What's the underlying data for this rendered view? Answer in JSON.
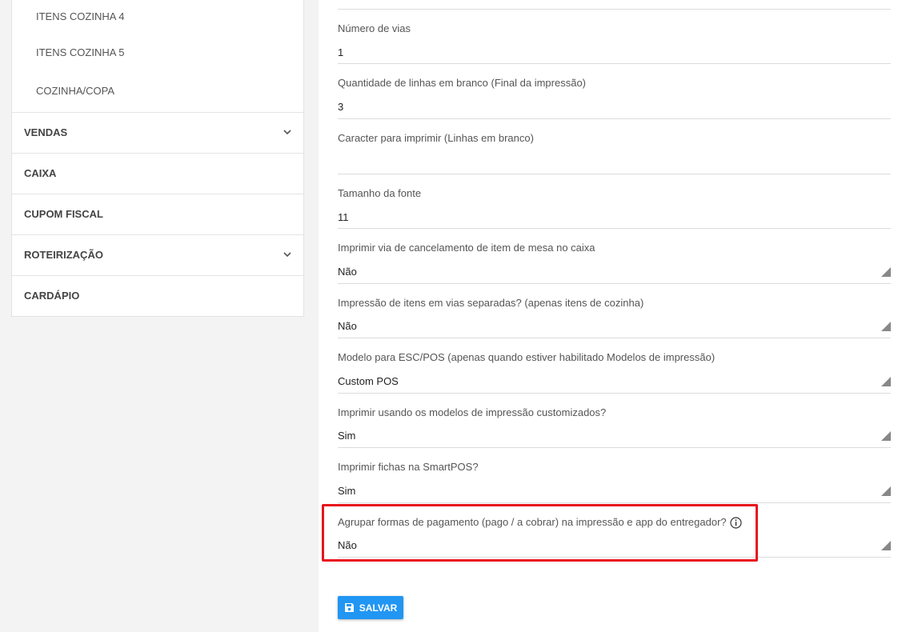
{
  "sidebar": {
    "sub_items": [
      "ITENS COZINHA 4",
      "ITENS COZINHA 5",
      "COZINHA/COPA"
    ],
    "menu": [
      {
        "label": "VENDAS",
        "has_chevron": true
      },
      {
        "label": "CAIXA",
        "has_chevron": false
      },
      {
        "label": "CUPOM FISCAL",
        "has_chevron": false
      },
      {
        "label": "ROTEIRIZAÇÃO",
        "has_chevron": true
      },
      {
        "label": "CARDÁPIO",
        "has_chevron": false
      }
    ]
  },
  "form": {
    "fields": [
      {
        "label": "Número de vias",
        "value": "1",
        "type": "text"
      },
      {
        "label": "Quantidade de linhas em branco (Final da impressão)",
        "value": "3",
        "type": "text"
      },
      {
        "label": "Caracter para imprimir (Linhas em branco)",
        "value": "",
        "type": "text"
      },
      {
        "label": "Tamanho da fonte",
        "value": "11",
        "type": "text"
      },
      {
        "label": "Imprimir via de cancelamento de item de mesa no caixa",
        "value": "Não",
        "type": "select"
      },
      {
        "label": "Impressão de itens em vias separadas? (apenas itens de cozinha)",
        "value": "Não",
        "type": "select"
      },
      {
        "label": "Modelo para ESC/POS (apenas quando estiver habilitado Modelos de impressão)",
        "value": "Custom POS",
        "type": "select"
      },
      {
        "label": "Imprimir usando os modelos de impressão customizados?",
        "value": "Sim",
        "type": "select"
      },
      {
        "label": "Imprimir fichas na SmartPOS?",
        "value": "Sim",
        "type": "select"
      },
      {
        "label": "Agrupar formas de pagamento (pago / a cobrar) na impressão e app do entregador?",
        "value": "Não",
        "type": "select",
        "info_icon": "info-icon"
      }
    ],
    "save_label": "SALVAR"
  },
  "colors": {
    "accent": "#2196f3",
    "highlight": "#e8131c"
  }
}
